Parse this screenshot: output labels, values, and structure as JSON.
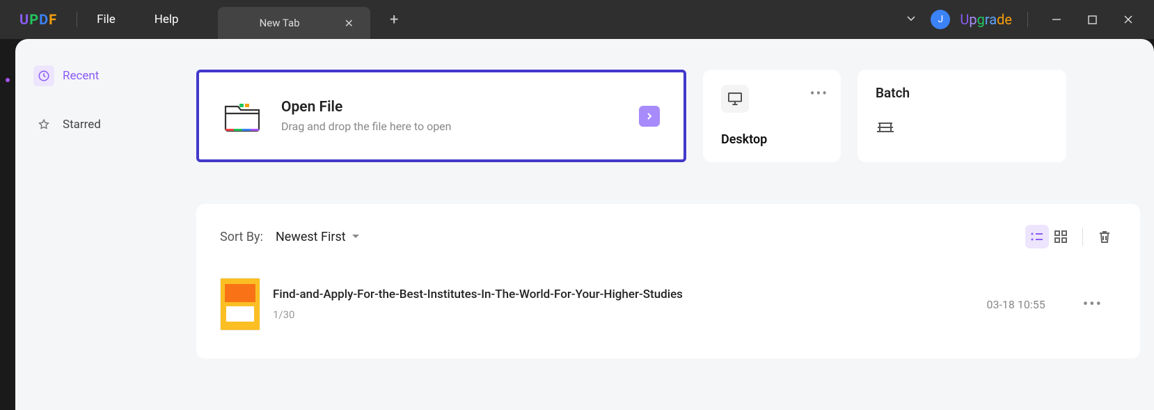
{
  "titlebar": {
    "menu": {
      "file": "File",
      "help": "Help"
    },
    "tab_label": "New Tab",
    "avatar_initial": "J",
    "upgrade": "Upgrade"
  },
  "sidebar": {
    "recent": "Recent",
    "starred": "Starred"
  },
  "open_card": {
    "title": "Open File",
    "subtitle": "Drag and drop the file here to open"
  },
  "desktop_card": {
    "label": "Desktop"
  },
  "batch_card": {
    "label": "Batch"
  },
  "files": {
    "sort_label": "Sort By:",
    "sort_value": "Newest First",
    "items": [
      {
        "name": "Find-and-Apply-For-the-Best-Institutes-In-The-World-For-Your-Higher-Studies",
        "pages": "1/30",
        "date": "03-18 10:55"
      }
    ]
  }
}
